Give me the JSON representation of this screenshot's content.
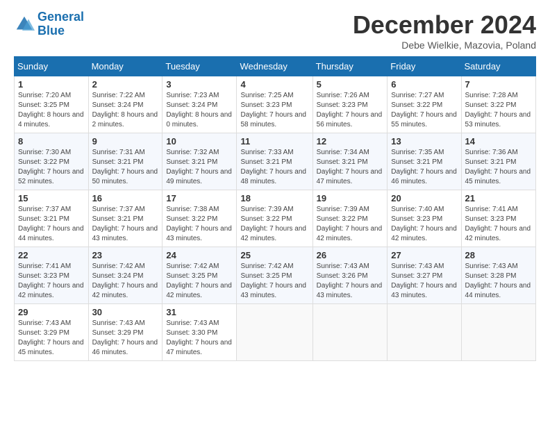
{
  "logo": {
    "line1": "General",
    "line2": "Blue"
  },
  "title": "December 2024",
  "subtitle": "Debe Wielkie, Mazovia, Poland",
  "days_header": [
    "Sunday",
    "Monday",
    "Tuesday",
    "Wednesday",
    "Thursday",
    "Friday",
    "Saturday"
  ],
  "weeks": [
    [
      {
        "day": 1,
        "sunrise": "7:20 AM",
        "sunset": "3:25 PM",
        "daylight": "8 hours and 4 minutes."
      },
      {
        "day": 2,
        "sunrise": "7:22 AM",
        "sunset": "3:24 PM",
        "daylight": "8 hours and 2 minutes."
      },
      {
        "day": 3,
        "sunrise": "7:23 AM",
        "sunset": "3:24 PM",
        "daylight": "8 hours and 0 minutes."
      },
      {
        "day": 4,
        "sunrise": "7:25 AM",
        "sunset": "3:23 PM",
        "daylight": "7 hours and 58 minutes."
      },
      {
        "day": 5,
        "sunrise": "7:26 AM",
        "sunset": "3:23 PM",
        "daylight": "7 hours and 56 minutes."
      },
      {
        "day": 6,
        "sunrise": "7:27 AM",
        "sunset": "3:22 PM",
        "daylight": "7 hours and 55 minutes."
      },
      {
        "day": 7,
        "sunrise": "7:28 AM",
        "sunset": "3:22 PM",
        "daylight": "7 hours and 53 minutes."
      }
    ],
    [
      {
        "day": 8,
        "sunrise": "7:30 AM",
        "sunset": "3:22 PM",
        "daylight": "7 hours and 52 minutes."
      },
      {
        "day": 9,
        "sunrise": "7:31 AM",
        "sunset": "3:21 PM",
        "daylight": "7 hours and 50 minutes."
      },
      {
        "day": 10,
        "sunrise": "7:32 AM",
        "sunset": "3:21 PM",
        "daylight": "7 hours and 49 minutes."
      },
      {
        "day": 11,
        "sunrise": "7:33 AM",
        "sunset": "3:21 PM",
        "daylight": "7 hours and 48 minutes."
      },
      {
        "day": 12,
        "sunrise": "7:34 AM",
        "sunset": "3:21 PM",
        "daylight": "7 hours and 47 minutes."
      },
      {
        "day": 13,
        "sunrise": "7:35 AM",
        "sunset": "3:21 PM",
        "daylight": "7 hours and 46 minutes."
      },
      {
        "day": 14,
        "sunrise": "7:36 AM",
        "sunset": "3:21 PM",
        "daylight": "7 hours and 45 minutes."
      }
    ],
    [
      {
        "day": 15,
        "sunrise": "7:37 AM",
        "sunset": "3:21 PM",
        "daylight": "7 hours and 44 minutes."
      },
      {
        "day": 16,
        "sunrise": "7:37 AM",
        "sunset": "3:21 PM",
        "daylight": "7 hours and 43 minutes."
      },
      {
        "day": 17,
        "sunrise": "7:38 AM",
        "sunset": "3:22 PM",
        "daylight": "7 hours and 43 minutes."
      },
      {
        "day": 18,
        "sunrise": "7:39 AM",
        "sunset": "3:22 PM",
        "daylight": "7 hours and 42 minutes."
      },
      {
        "day": 19,
        "sunrise": "7:39 AM",
        "sunset": "3:22 PM",
        "daylight": "7 hours and 42 minutes."
      },
      {
        "day": 20,
        "sunrise": "7:40 AM",
        "sunset": "3:23 PM",
        "daylight": "7 hours and 42 minutes."
      },
      {
        "day": 21,
        "sunrise": "7:41 AM",
        "sunset": "3:23 PM",
        "daylight": "7 hours and 42 minutes."
      }
    ],
    [
      {
        "day": 22,
        "sunrise": "7:41 AM",
        "sunset": "3:23 PM",
        "daylight": "7 hours and 42 minutes."
      },
      {
        "day": 23,
        "sunrise": "7:42 AM",
        "sunset": "3:24 PM",
        "daylight": "7 hours and 42 minutes."
      },
      {
        "day": 24,
        "sunrise": "7:42 AM",
        "sunset": "3:25 PM",
        "daylight": "7 hours and 42 minutes."
      },
      {
        "day": 25,
        "sunrise": "7:42 AM",
        "sunset": "3:25 PM",
        "daylight": "7 hours and 43 minutes."
      },
      {
        "day": 26,
        "sunrise": "7:43 AM",
        "sunset": "3:26 PM",
        "daylight": "7 hours and 43 minutes."
      },
      {
        "day": 27,
        "sunrise": "7:43 AM",
        "sunset": "3:27 PM",
        "daylight": "7 hours and 43 minutes."
      },
      {
        "day": 28,
        "sunrise": "7:43 AM",
        "sunset": "3:28 PM",
        "daylight": "7 hours and 44 minutes."
      }
    ],
    [
      {
        "day": 29,
        "sunrise": "7:43 AM",
        "sunset": "3:29 PM",
        "daylight": "7 hours and 45 minutes."
      },
      {
        "day": 30,
        "sunrise": "7:43 AM",
        "sunset": "3:29 PM",
        "daylight": "7 hours and 46 minutes."
      },
      {
        "day": 31,
        "sunrise": "7:43 AM",
        "sunset": "3:30 PM",
        "daylight": "7 hours and 47 minutes."
      },
      null,
      null,
      null,
      null
    ]
  ]
}
